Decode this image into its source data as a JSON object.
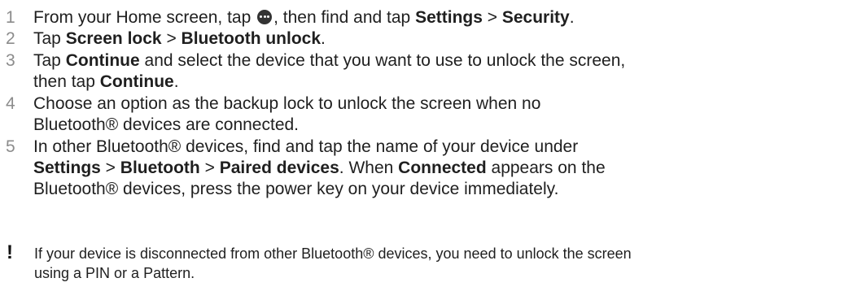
{
  "steps": [
    {
      "number": "1",
      "parts": {
        "a": "From your Home screen, tap ",
        "b": ", then find and tap ",
        "c": "Settings",
        "d": " > ",
        "e": "Security",
        "f": "."
      },
      "icon": "apps-icon"
    },
    {
      "number": "2",
      "parts": {
        "a": "Tap ",
        "b": "Screen lock",
        "c": " > ",
        "d": "Bluetooth unlock",
        "e": "."
      }
    },
    {
      "number": "3",
      "parts": {
        "a": "Tap ",
        "b": "Continue",
        "c": " and select the device that you want to use to unlock the screen,",
        "d": "then tap ",
        "e": "Continue",
        "f": "."
      }
    },
    {
      "number": "4",
      "parts": {
        "a": "Choose an option as the backup lock to unlock the screen when no",
        "b": "Bluetooth® devices are connected."
      }
    },
    {
      "number": "5",
      "parts": {
        "a": "In other Bluetooth® devices, find and tap the name of your device under",
        "b": "Settings",
        "c": " > ",
        "d": "Bluetooth",
        "e": " > ",
        "f": "Paired devices",
        "g": ". When ",
        "h": "Connected",
        "i": " appears on the",
        "j": "Bluetooth® devices, press the power key on your device immediately."
      }
    }
  ],
  "note": {
    "icon": "!",
    "line1": "If your device is disconnected from other Bluetooth® devices, you need to unlock the screen",
    "line2": "using a PIN or a Pattern."
  }
}
